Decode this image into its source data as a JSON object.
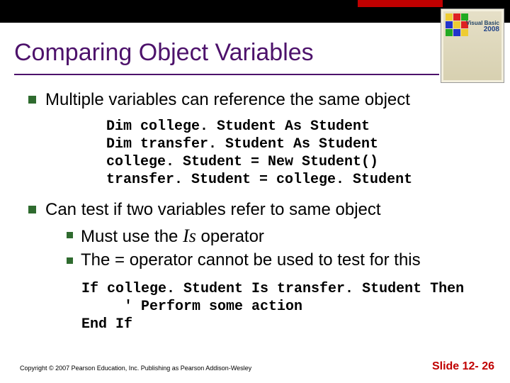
{
  "title": "Comparing Object Variables",
  "bullets": {
    "b1": "Multiple variables can reference the same object",
    "b2": "Can test if two variables refer to same object",
    "sub1_pre": "Must use the ",
    "sub1_op": "Is",
    "sub1_post": " operator",
    "sub2": "The = operator cannot be used to test for this"
  },
  "code1": "Dim college. Student As Student\nDim transfer. Student As Student\ncollege. Student = New Student()\ntransfer. Student = college. Student",
  "code2": "If college. Student Is transfer. Student Then\n     ' Perform some action\nEnd If",
  "footer": {
    "copyright": "Copyright © 2007 Pearson Education, Inc. Publishing as Pearson Addison-Wesley",
    "slide": "Slide 12- 26"
  },
  "book": {
    "line1": "Visual Basic",
    "year": "2008"
  }
}
